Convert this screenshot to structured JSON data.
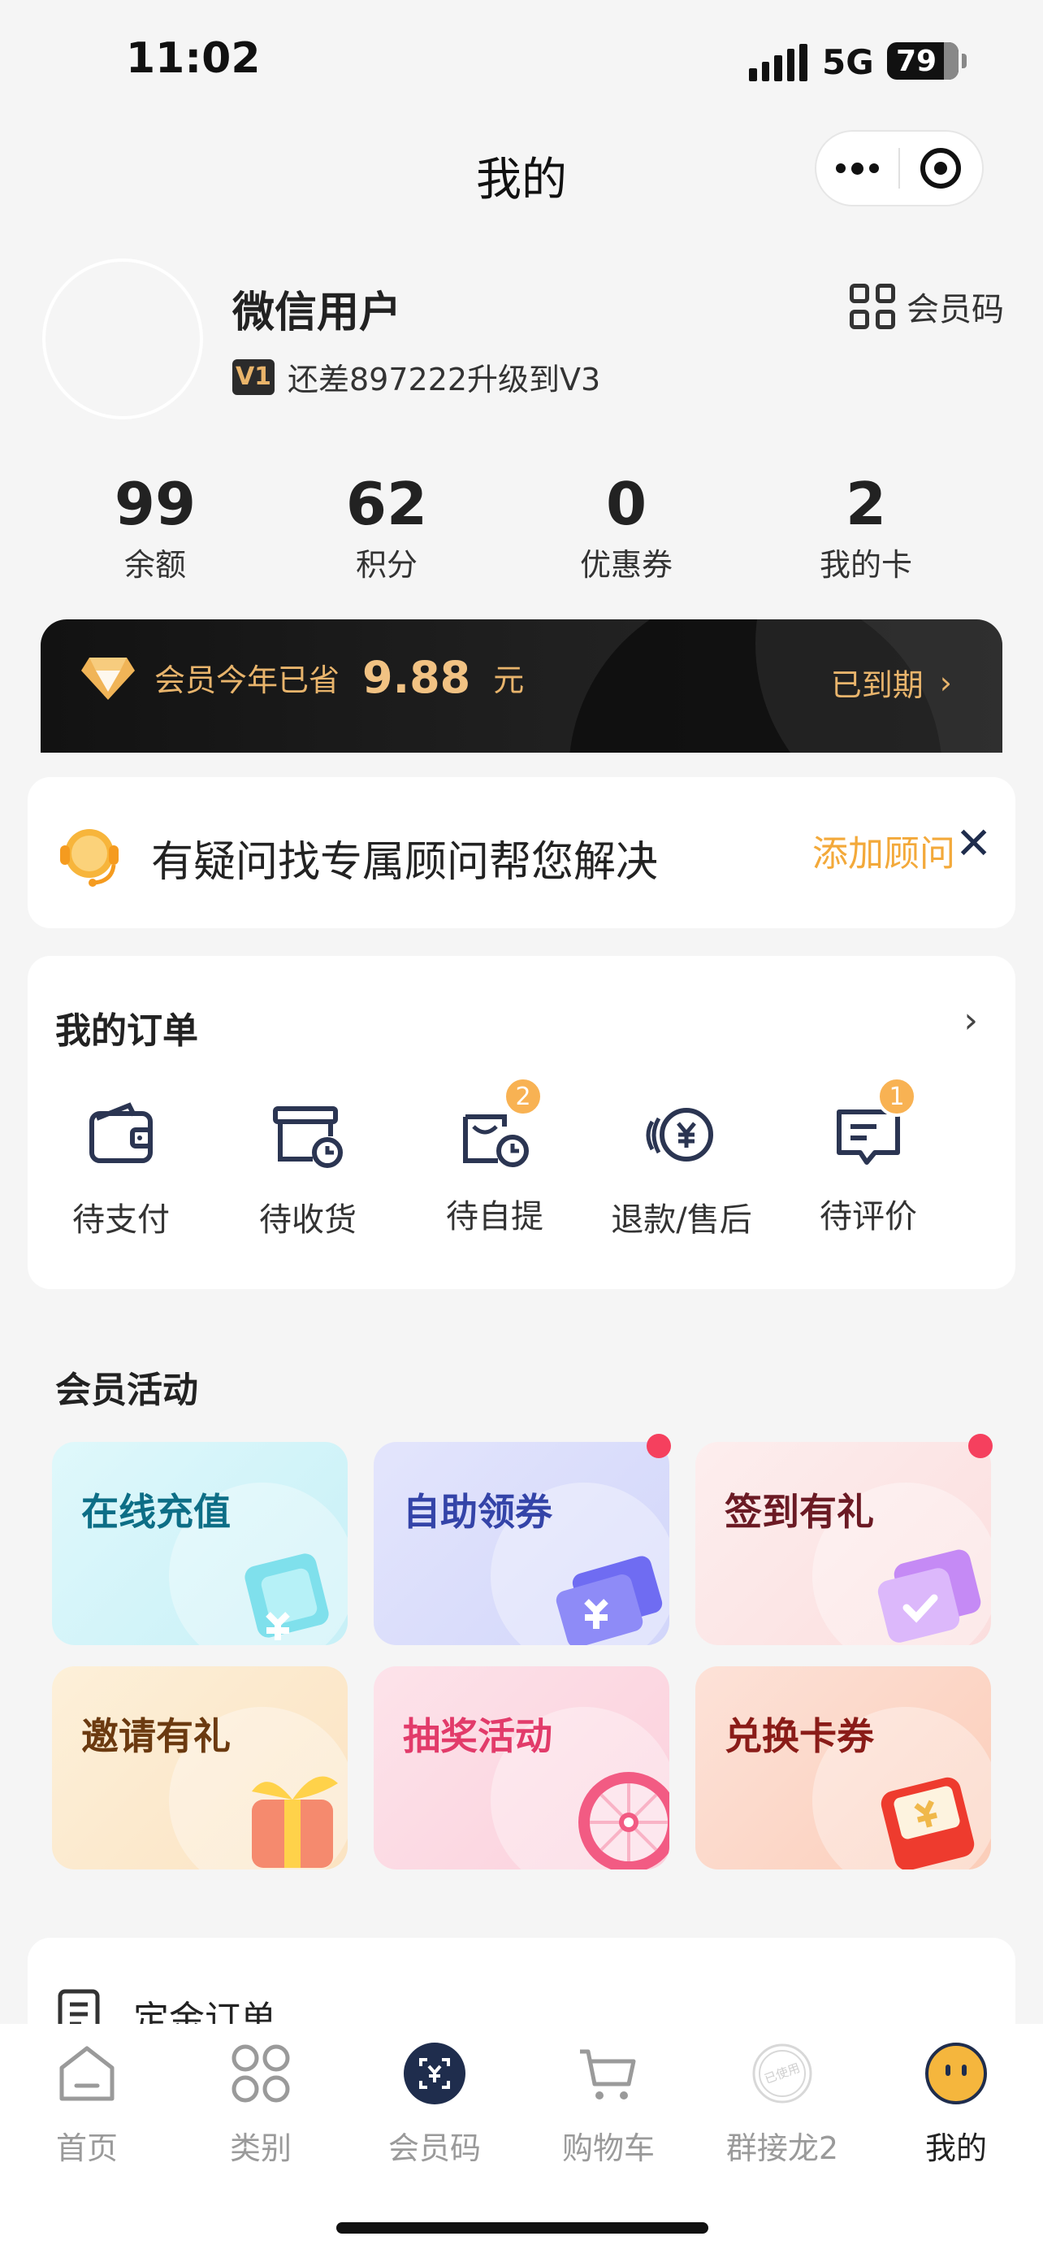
{
  "status_bar": {
    "time": "11:02",
    "network": "5G",
    "battery": "79"
  },
  "nav": {
    "title": "我的"
  },
  "profile": {
    "username": "微信用户",
    "level_badge": "V1",
    "level_text": "还差897222升级到V3",
    "member_code_label": "会员码"
  },
  "stats": [
    {
      "value": "99",
      "label": "余额"
    },
    {
      "value": "62",
      "label": "积分"
    },
    {
      "value": "0",
      "label": "优惠券"
    },
    {
      "value": "2",
      "label": "我的卡"
    }
  ],
  "savings": {
    "label": "会员今年已省",
    "amount": "9.88",
    "unit": "元",
    "status": "已到期",
    "arrow": "›",
    "accent": "#e8b46c"
  },
  "advisor": {
    "text": "有疑问找专属顾问帮您解决",
    "action": "添加顾问",
    "close": "✕",
    "action_color": "#f3a93a"
  },
  "orders": {
    "title": "我的订单",
    "arrow": "›",
    "items": [
      {
        "label": "待支付",
        "icon": "wallet-icon",
        "badge": ""
      },
      {
        "label": "待收货",
        "icon": "package-clock-icon",
        "badge": ""
      },
      {
        "label": "待自提",
        "icon": "pickup-clock-icon",
        "badge": "2"
      },
      {
        "label": "退款/售后",
        "icon": "refund-yen-icon",
        "badge": ""
      },
      {
        "label": "待评价",
        "icon": "review-icon",
        "badge": "1"
      }
    ]
  },
  "activities": {
    "title": "会员活动",
    "items": [
      {
        "label": "在线充值",
        "icon": "recharge-icon",
        "color": "#0d6e86",
        "dot": false
      },
      {
        "label": "自助领券",
        "icon": "coupon-icon",
        "color": "#3444a8",
        "dot": true
      },
      {
        "label": "签到有礼",
        "icon": "calendar-check-icon",
        "color": "#6b1a24",
        "dot": true
      },
      {
        "label": "邀请有礼",
        "icon": "gift-icon",
        "color": "#6b3a10",
        "dot": false
      },
      {
        "label": "抽奖活动",
        "icon": "lottery-wheel-icon",
        "color": "#e23b6a",
        "dot": false
      },
      {
        "label": "兑换卡券",
        "icon": "red-envelope-icon",
        "color": "#8a1c18",
        "dot": false
      }
    ]
  },
  "deposit": {
    "label": "定金订单"
  },
  "tabbar": {
    "items": [
      {
        "label": "首页",
        "icon": "home-icon",
        "active": false
      },
      {
        "label": "类别",
        "icon": "category-icon",
        "active": false
      },
      {
        "label": "会员码",
        "icon": "member-code-icon",
        "active": false
      },
      {
        "label": "购物车",
        "icon": "cart-icon",
        "active": false
      },
      {
        "label": "群接龙2",
        "icon": "used-stamp-icon",
        "active": false
      },
      {
        "label": "我的",
        "icon": "smiley-icon",
        "active": true
      }
    ],
    "stamp_text": "已使用"
  }
}
